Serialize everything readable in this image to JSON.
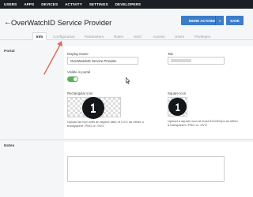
{
  "topnav": {
    "items": [
      "USERS",
      "APPS",
      "DEVICES",
      "ACTIVITY",
      "SETTINGS",
      "DEVELOPERS"
    ]
  },
  "header": {
    "back": "←",
    "title": "OverWatchID Service Provider",
    "more_actions": "MORE ACTIONS",
    "caret": "▾",
    "save": "SAVE"
  },
  "tabs": [
    "Info",
    "Configuration",
    "Parameters",
    "Rules",
    "SSO",
    "Access",
    "Users",
    "Privileges"
  ],
  "active_tab": "Info",
  "portal": {
    "section_label": "Portal",
    "display_name_label": "Display Name",
    "display_name_value": "OverWatchID Service Provider",
    "tab_label": "Tab",
    "visible_label": "Visible in portal",
    "visible": true,
    "rect_icon_label": "Rectangular Icon",
    "rect_icon_help": "Upload an icon with an aspect-ratio of 2.6:1 as either a transparent .PNG or .SVG",
    "square_icon_label": "Square Icon",
    "square_icon_help": "Upload a square icon at least 512x512px as either a transparent .PNG or .SVG"
  },
  "notes": {
    "section_label": "Notes",
    "value": ""
  },
  "colors": {
    "nav_bg": "#1b1f23",
    "primary": "#3d7cc9",
    "toggle_on": "#5bb05b",
    "annotation": "#e06a4f"
  },
  "icons": {
    "logo": "onelogin-1-logo",
    "annotation": "red-arrow"
  }
}
